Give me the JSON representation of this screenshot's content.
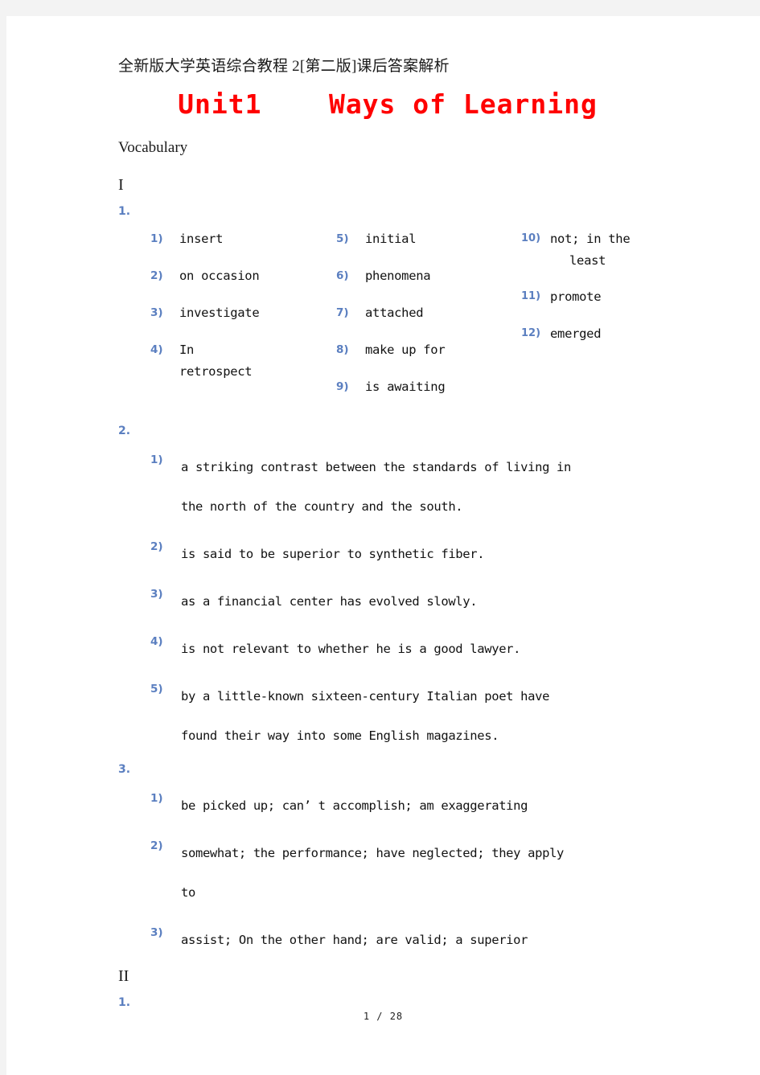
{
  "header": {
    "doc_title": "全新版大学英语综合教程 2[第二版]课后答案解析",
    "unit_title": "Unit1    Ways of Learning"
  },
  "colors": {
    "title_red": "#ff0000",
    "marker_blue": "#5b7fc0",
    "body_black": "#121212",
    "page_background": "#ffffff",
    "canvas_background": "#f3f3f3"
  },
  "sections": {
    "vocabulary_label": "Vocabulary",
    "roman_1": "I",
    "roman_2": "II",
    "num_1": "1.",
    "num_2": "2.",
    "num_3": "3.",
    "num_1_after_II": "1."
  },
  "word_bank": {
    "column_1": [
      {
        "marker": "1)",
        "line1": "insert",
        "line2": ""
      },
      {
        "marker": "2)",
        "line1": "on occasion",
        "line2": ""
      },
      {
        "marker": "3)",
        "line1": "investigate",
        "line2": ""
      },
      {
        "marker": "4)",
        "line1": "In",
        "line2": "retrospect"
      }
    ],
    "column_2": [
      {
        "marker": "5)",
        "line1": "initial",
        "line2": ""
      },
      {
        "marker": "6)",
        "line1": "phenomena",
        "line2": ""
      },
      {
        "marker": "7)",
        "line1": "attached",
        "line2": ""
      },
      {
        "marker": "8)",
        "line1": "make up for",
        "line2": ""
      },
      {
        "marker": "9)",
        "line1": "is awaiting",
        "line2": ""
      }
    ],
    "column_3": [
      {
        "marker": "10)",
        "line1": "not; in the",
        "line2": "least"
      },
      {
        "marker": "11)",
        "line1": "promote",
        "line2": ""
      },
      {
        "marker": "12)",
        "line1": "emerged",
        "line2": ""
      }
    ]
  },
  "sentence_list_2": [
    {
      "marker": "1)",
      "line1": "a striking contrast between the standards of living in",
      "line2": "the north of the country and the south."
    },
    {
      "marker": "2)",
      "line1": "is said to be superior to synthetic fiber.",
      "line2": ""
    },
    {
      "marker": "3)",
      "line1": "as a financial center has evolved slowly.",
      "line2": ""
    },
    {
      "marker": "4)",
      "line1": "is not relevant to whether he is a good lawyer.",
      "line2": ""
    },
    {
      "marker": "5)",
      "line1": "by a little-known sixteen-century Italian poet have",
      "line2": "found their way into some English magazines."
    }
  ],
  "sentence_list_3": [
    {
      "marker": "1)",
      "line1": "be picked up; can’ t accomplish; am exaggerating",
      "line2": ""
    },
    {
      "marker": "2)",
      "line1": "somewhat; the performance; have neglected; they apply",
      "line2": "to"
    },
    {
      "marker": "3)",
      "line1": "assist; On the other hand; are valid; a superior",
      "line2": ""
    }
  ],
  "footer": {
    "page_indicator": "1 / 28"
  }
}
